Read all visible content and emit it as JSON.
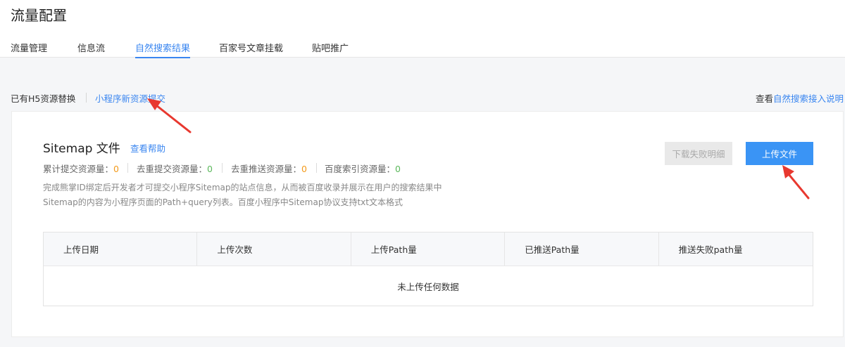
{
  "page": {
    "title": "流量配置"
  },
  "tabs": [
    {
      "label": "流量管理",
      "active": false
    },
    {
      "label": "信息流",
      "active": false
    },
    {
      "label": "自然搜索结果",
      "active": true
    },
    {
      "label": "百家号文章挂载",
      "active": false
    },
    {
      "label": "贴吧推广",
      "active": false
    }
  ],
  "subnav": {
    "left_item": "已有H5资源替换",
    "right_item": "小程序新资源提交",
    "help_prefix": "查看",
    "help_link": "自然搜索接入说明"
  },
  "sitemap": {
    "title": "Sitemap 文件",
    "help": "查看帮助",
    "stats": [
      {
        "label": "累计提交资源量：",
        "value": "0",
        "color": "#f39a1b"
      },
      {
        "label": "去重提交资源量：",
        "value": "0",
        "color": "#5cb85c"
      },
      {
        "label": "去重推送资源量：",
        "value": "0",
        "color": "#f39a1b"
      },
      {
        "label": "百度索引资源量：",
        "value": "0",
        "color": "#5cb85c"
      }
    ],
    "desc1": "完成熊掌ID绑定后开发者才可提交小程序Sitemap的站点信息，从而被百度收录并展示在用户的搜索结果中",
    "desc2": "Sitemap的内容为小程序页面的Path+query列表。百度小程序中Sitemap协议支持txt文本格式",
    "download_btn": "下载失败明细",
    "upload_btn": "上传文件"
  },
  "table": {
    "columns": [
      "上传日期",
      "上传次数",
      "上传Path量",
      "已推送Path量",
      "推送失败path量"
    ],
    "empty_text": "未上传任何数据"
  },
  "colors": {
    "accent": "#3a86f0",
    "annotation_arrow": "#e8382f"
  }
}
